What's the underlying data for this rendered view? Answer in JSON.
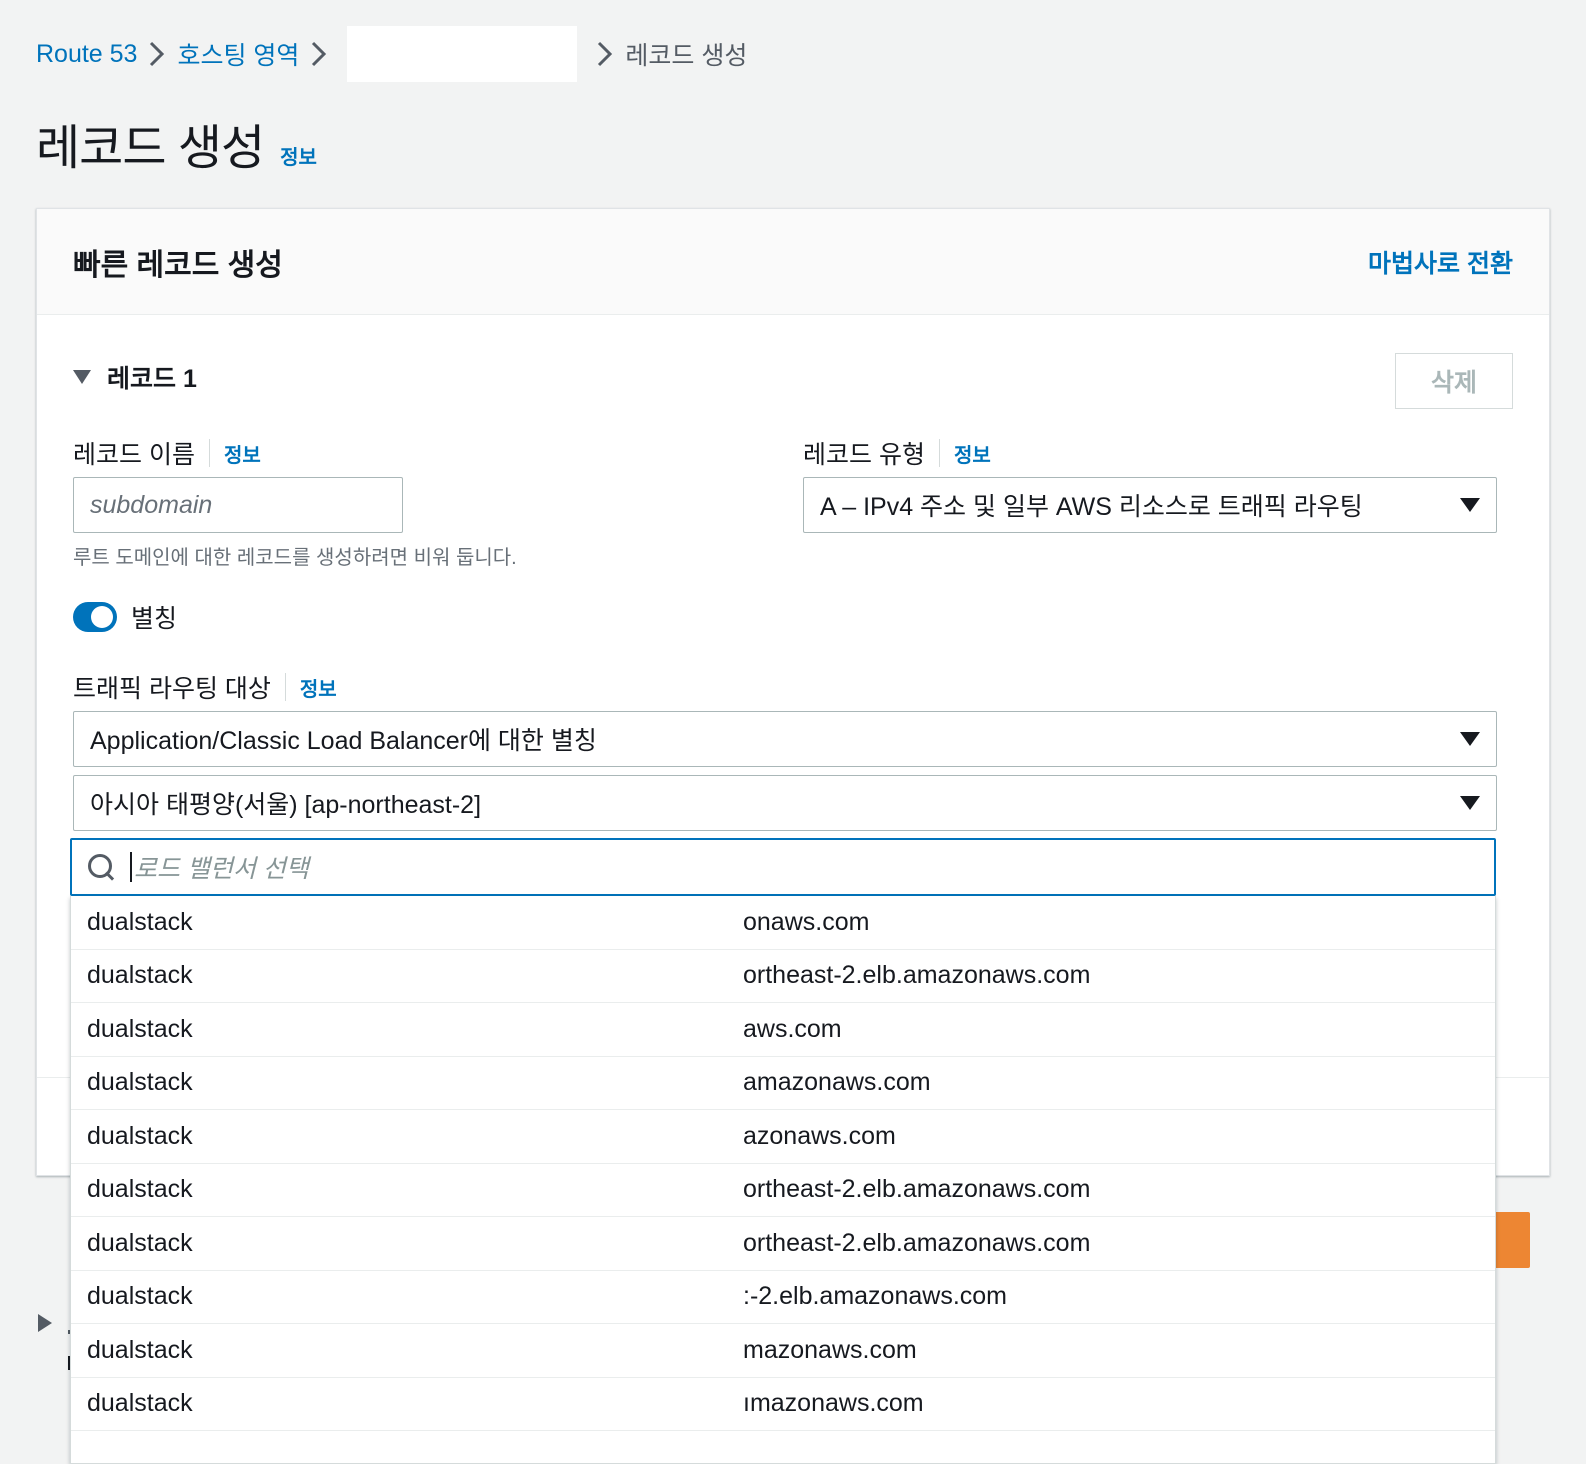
{
  "breadcrumb": {
    "route53": "Route 53",
    "hosted_zones": "호스팅 영역",
    "current": "레코드 생성"
  },
  "page": {
    "title": "레코드 생성",
    "info": "정보"
  },
  "panel": {
    "title": "빠른 레코드 생성",
    "wizard_link": "마법사로 전환"
  },
  "record": {
    "heading": "레코드 1",
    "delete_label": "삭제",
    "name_label": "레코드 이름",
    "name_info": "정보",
    "name_placeholder": "subdomain",
    "name_hint": "루트 도메인에 대한 레코드를 생성하려면 비워 둡니다.",
    "type_label": "레코드 유형",
    "type_info": "정보",
    "type_value": "A – IPv4 주소 및 일부 AWS 리소스로 트래픽 라우팅",
    "alias_label": "별칭",
    "alias_enabled": true,
    "target_label": "트래픽 라우팅 대상",
    "target_info": "정보",
    "target_value": "Application/Classic Load Balancer에 대한 별칭",
    "region_value": "아시아 태평양(서울) [ap-northeast-2]",
    "lb_search_placeholder": "로드 밸런서 선택"
  },
  "lb_options": [
    {
      "prefix": "dualstack",
      "suffix": "onaws.com"
    },
    {
      "prefix": "dualstack",
      "suffix": "ortheast-2.elb.amazonaws.com"
    },
    {
      "prefix": "dualstack",
      "suffix": "aws.com"
    },
    {
      "prefix": "dualstack",
      "suffix": "amazonaws.com"
    },
    {
      "prefix": "dualstack",
      "suffix": "azonaws.com"
    },
    {
      "prefix": "dualstack",
      "suffix": "ortheast-2.elb.amazonaws.com"
    },
    {
      "prefix": "dualstack",
      "suffix": "ortheast-2.elb.amazonaws.com"
    },
    {
      "prefix": "dualstack",
      "suffix": ":-2.elb.amazonaws.com"
    },
    {
      "prefix": "dualstack",
      "suffix": "mazonaws.com"
    },
    {
      "prefix": "dualstack",
      "suffix": "ımazonaws.com"
    }
  ],
  "colors": {
    "link": "#0073bb",
    "primary_button": "#ec7211",
    "background": "#f2f3f3"
  }
}
